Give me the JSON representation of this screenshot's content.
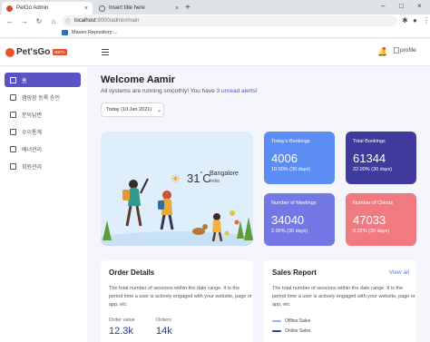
{
  "browser": {
    "tabs": [
      {
        "label": "PetGo Admin",
        "active": true
      },
      {
        "label": "Insert title here",
        "active": false
      }
    ],
    "url_host": "localhost",
    "url_path": ":9000/admin/main",
    "bookmark": "Maven Repository:..."
  },
  "header": {
    "logo_text": "Pet'sGo",
    "logo_badge": "BETA",
    "profile_alt": "profile"
  },
  "sidebar": {
    "items": [
      {
        "label": "홈",
        "active": true
      },
      {
        "label": "캠핑장 등록 승인",
        "active": false
      },
      {
        "label": "문의답변",
        "active": false
      },
      {
        "label": "수익통계",
        "active": false
      },
      {
        "label": "배너관리",
        "active": false
      },
      {
        "label": "회원관리",
        "active": false
      }
    ]
  },
  "main": {
    "welcome": "Welcome Aamir",
    "subtitle_prefix": "All systems are running smoothly! You have ",
    "subtitle_alert": "3 unread alerts!",
    "date_label": "Today (10 Jan 2021)"
  },
  "weather": {
    "temp": "31",
    "unit": "C",
    "city": "Bangalore",
    "country": "India"
  },
  "stats": [
    {
      "label": "Today's Bookings",
      "value": "4006",
      "change": "10.00% (30 days)",
      "color": "#5b8df5"
    },
    {
      "label": "Total Bookings",
      "value": "61344",
      "change": "22.00% (30 days)",
      "color": "#3f3a9b"
    },
    {
      "label": "Number of Meetings",
      "value": "34040",
      "change": "2.00% (30 days)",
      "color": "#7378e6"
    },
    {
      "label": "Number of Clients",
      "value": "47033",
      "change": "0.22% (30 days)",
      "color": "#f07a7f"
    }
  ],
  "order_details": {
    "title": "Order Details",
    "text": "The total number of sessions within the date range. It is the period time a user is actively engaged with your website, page or app, etc",
    "order_value_label": "Order value",
    "order_value": "12.3k",
    "orders_label": "Orders",
    "orders": "14k"
  },
  "sales_report": {
    "title": "Sales Report",
    "view_all": "View all",
    "text": "The total number of sessions within the date range. It is the period time a user is actively engaged with your website, page or app, etc",
    "legend": [
      {
        "label": "Offline Sales",
        "color": "#8fb6f5"
      },
      {
        "label": "Online Sales",
        "color": "#3f3a9b"
      }
    ]
  }
}
